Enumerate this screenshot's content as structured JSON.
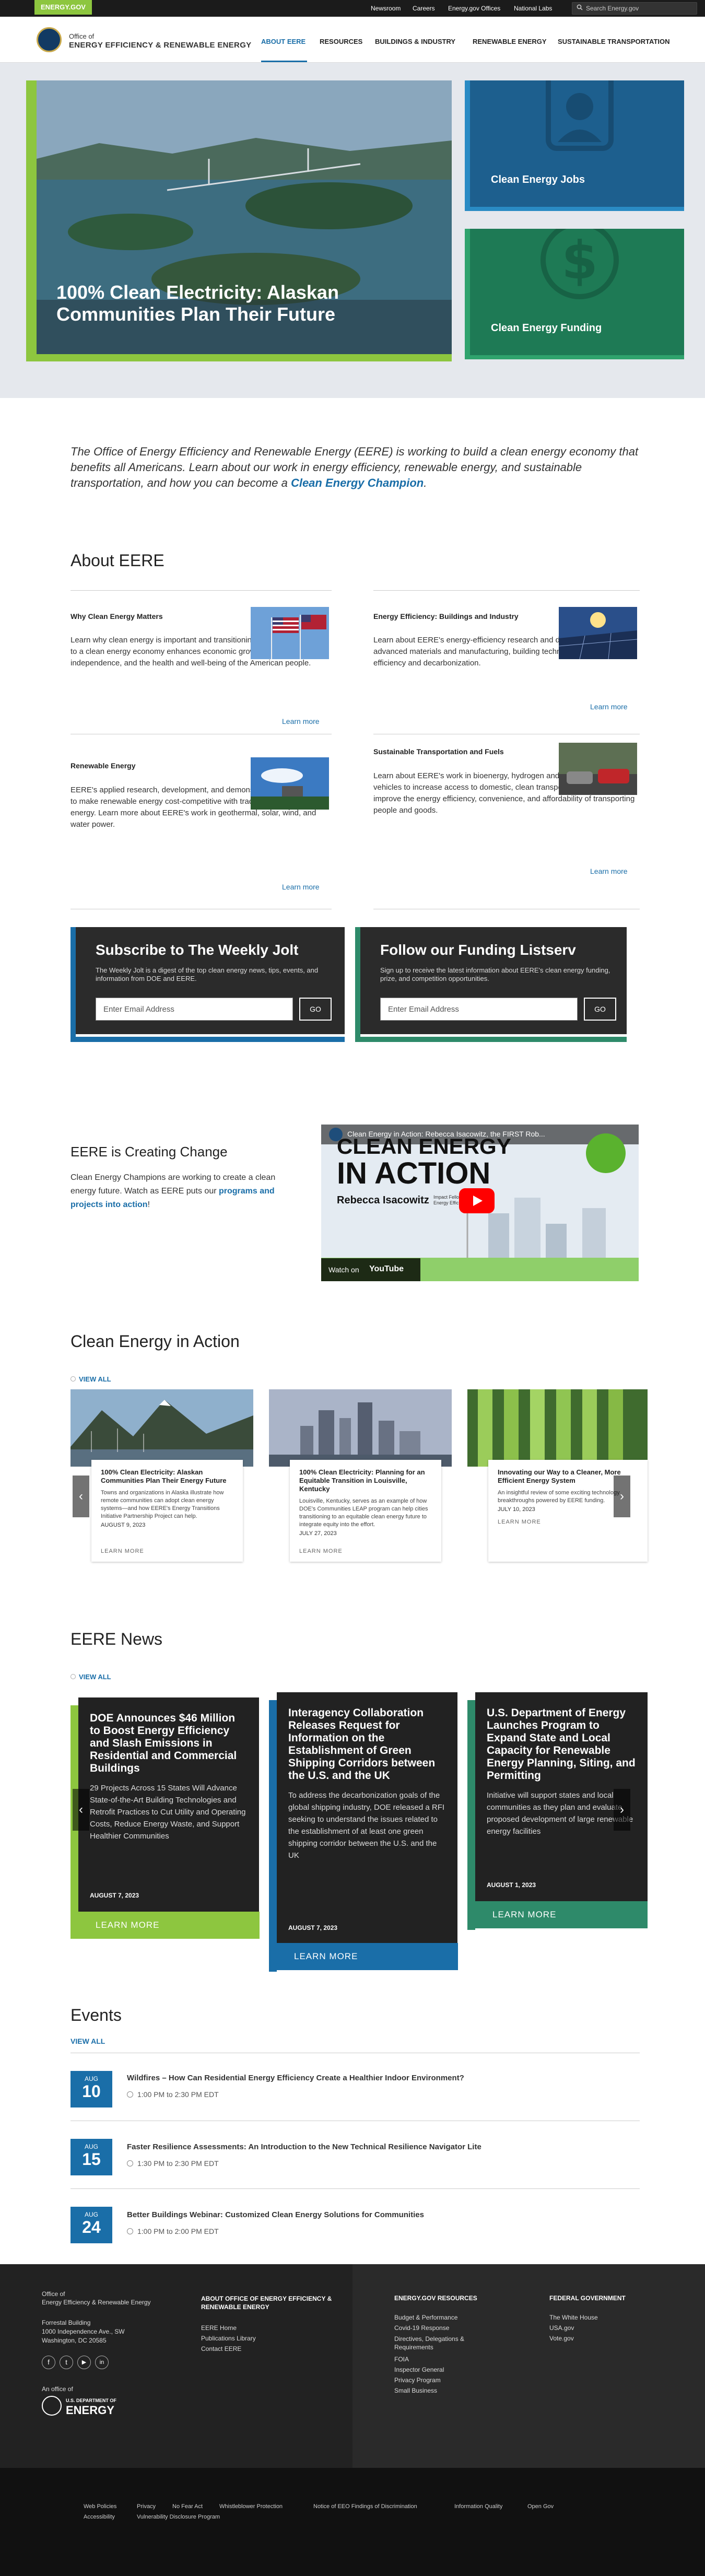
{
  "topbar": {
    "logo": "ENERGY.GOV",
    "links": [
      "Newsroom",
      "Careers",
      "Energy.gov Offices",
      "National Labs"
    ],
    "search_placeholder": "Search Energy.gov"
  },
  "header": {
    "office_of": "Office of",
    "office_name": "ENERGY EFFICIENCY & RENEWABLE ENERGY",
    "nav": [
      "ABOUT EERE",
      "RESOURCES",
      "BUILDINGS & INDUSTRY",
      "RENEWABLE ENERGY",
      "SUSTAINABLE TRANSPORTATION"
    ]
  },
  "hero": {
    "main_title": "100% Clean Electricity: Alaskan Communities Plan Their Future",
    "side1": "Clean Energy Jobs",
    "side2": "Clean Energy Funding"
  },
  "intro": {
    "text": "The Office of Energy Efficiency and Renewable Energy (EERE) is working to build a clean energy economy that benefits all Americans. Learn about our work in energy efficiency, renewable energy, and sustainable transportation, and how you can become a ",
    "link": "Clean Energy Champion",
    "end": "."
  },
  "about": {
    "heading": "About EERE",
    "items": [
      {
        "title": "Why Clean Energy Matters",
        "text": "Learn why clean energy is important and transitioning the United States to a clean energy economy enhances economic growth, energy independence, and the health and well-being of the American people.",
        "link": "Learn more"
      },
      {
        "title": "Energy Efficiency: Buildings and Industry",
        "text": "Learn about EERE's energy-efficiency research and development in advanced materials and manufacturing, building technologies, and industrial efficiency and decarbonization.",
        "link": "Learn more"
      },
      {
        "title": "Renewable Energy",
        "text": "EERE's applied research, development, and demonstration activities aim to make renewable energy cost-competitive with traditional sources of energy. Learn more about EERE's work in geothermal, solar, wind, and water power.",
        "link": "Learn more"
      },
      {
        "title": "Sustainable Transportation and Fuels",
        "text": "Learn about EERE's work in bioenergy, hydrogen and fuel cells, and vehicles to increase access to domestic, clean transportation fuels and improve the energy efficiency, convenience, and affordability of transporting people and goods.",
        "link": "Learn more"
      }
    ]
  },
  "subscribe": {
    "jolt_title": "Subscribe to The Weekly Jolt",
    "jolt_text": "The Weekly Jolt is a digest of the top clean energy news, tips, events, and information from DOE and EERE.",
    "list_title": "Follow our Funding Listserv",
    "list_text": "Sign up to receive the latest information about EERE's clean energy funding, prize, and competition opportunities.",
    "placeholder": "Enter Email Address",
    "go": "GO"
  },
  "change": {
    "heading": "EERE is Creating Change",
    "text": "Clean Energy Champions are working to create a clean energy future. Watch as EERE puts our ",
    "link": "programs and projects into action",
    "end": "!",
    "video_title": "Clean Energy in Action: Rebecca Isacowitz, the FIRST Rob...",
    "video_headline_1": "CLEAN ENERGY",
    "video_headline_2": "IN ACTION",
    "video_name": "Rebecca Isacowitz",
    "video_sub": "Impact Fellow at Office of Energy Efficiency",
    "watch_on": "Watch on",
    "youtube": "YouTube"
  },
  "action": {
    "heading": "Clean Energy in Action",
    "view_all": "VIEW ALL",
    "cards": [
      {
        "title": "100% Clean Electricity: Alaskan Communities Plan Their Energy Future",
        "text": "Towns and organizations in Alaska illustrate how remote communities can adopt clean energy systems—and how EERE's Energy Transitions Initiative Partnership Project can help.",
        "date": "AUGUST 9, 2023",
        "more": "LEARN MORE"
      },
      {
        "title": "100% Clean Electricity: Planning for an Equitable Transition in Louisville, Kentucky",
        "text": "Louisville, Kentucky, serves as an example of how DOE's Communities LEAP program can help cities transitioning to an equitable clean energy future to integrate equity into the effort.",
        "date": "JULY 27, 2023",
        "more": "LEARN MORE"
      },
      {
        "title": "Innovating our Way to a Cleaner, More Efficient Energy System",
        "text": "An insightful review of some exciting technology breakthroughs powered by EERE funding.",
        "date": "JULY 10, 2023",
        "more": "LEARN MORE"
      }
    ]
  },
  "news": {
    "heading": "EERE News",
    "view_all": "VIEW ALL",
    "cards": [
      {
        "title": "DOE Announces $46 Million to Boost Energy Efficiency and Slash Emissions in Residential and Commercial Buildings",
        "text": "29 Projects Across 15 States Will Advance State-of-the-Art Building Technologies and Retrofit Practices to Cut Utility and Operating Costs, Reduce Energy Waste, and Support Healthier Communities",
        "date": "AUGUST 7, 2023",
        "more": "LEARN MORE",
        "color": "#8dc63f"
      },
      {
        "title": "Interagency Collaboration Releases Request for Information on the Establishment of Green Shipping Corridors between the U.S. and the UK",
        "text": "To address the decarbonization goals of the global shipping industry, DOE released a RFI seeking to understand the issues related to the establishment of at least one green shipping corridor between the U.S. and the UK",
        "date": "AUGUST 7, 2023",
        "more": "LEARN MORE",
        "color": "#1a6ea8"
      },
      {
        "title": "U.S. Department of Energy Launches Program to Expand State and Local Capacity for Renewable Energy Planning, Siting, and Permitting",
        "text": "Initiative will support states and local communities as they plan and evaluate proposed development of large renewable energy facilities",
        "date": "AUGUST 1, 2023",
        "more": "LEARN MORE",
        "color": "#2e8a6a"
      }
    ]
  },
  "events": {
    "heading": "Events",
    "view_all": "VIEW ALL",
    "items": [
      {
        "month": "AUG",
        "day": "10",
        "title": "Wildfires – How Can Residential Energy Efficiency Create a Healthier Indoor Environment?",
        "time": "1:00 PM to 2:30 PM EDT"
      },
      {
        "month": "AUG",
        "day": "15",
        "title": "Faster Resilience Assessments: An Introduction to the New Technical Resilience Navigator Lite",
        "time": "1:30 PM to 2:30 PM EDT"
      },
      {
        "month": "AUG",
        "day": "24",
        "title": "Better Buildings Webinar: Customized Clean Energy Solutions for Communities",
        "time": "1:00 PM to 2:00 PM EDT"
      }
    ]
  },
  "footer": {
    "office_of": "Office of",
    "office_name": "Energy Efficiency & Renewable Energy",
    "building": "Forrestal Building",
    "address1": "1000 Independence Ave., SW",
    "address2": "Washington, DC 20585",
    "an_office_of": "An office of",
    "doe_small": "U.S. DEPARTMENT OF",
    "doe_big": "ENERGY",
    "about_heading": "ABOUT OFFICE OF ENERGY EFFICIENCY & RENEWABLE ENERGY",
    "about_links": [
      "EERE Home",
      "Publications Library",
      "Contact EERE"
    ],
    "resources_heading": "ENERGY.GOV RESOURCES",
    "resources_links": [
      "Budget & Performance",
      "Covid-19 Response",
      "Directives, Delegations & Requirements",
      "FOIA",
      "Inspector General",
      "Privacy Program",
      "Small Business"
    ],
    "federal_heading": "FEDERAL GOVERNMENT",
    "federal_links": [
      "The White House",
      "USA.gov",
      "Vote.gov"
    ],
    "bottom_links": [
      "Web Policies",
      "Privacy",
      "No Fear Act",
      "Whistleblower Protection",
      "Notice of EEO Findings of Discrimination",
      "Information Quality",
      "Open Gov",
      "Accessibility",
      "Vulnerability Disclosure Program"
    ]
  }
}
